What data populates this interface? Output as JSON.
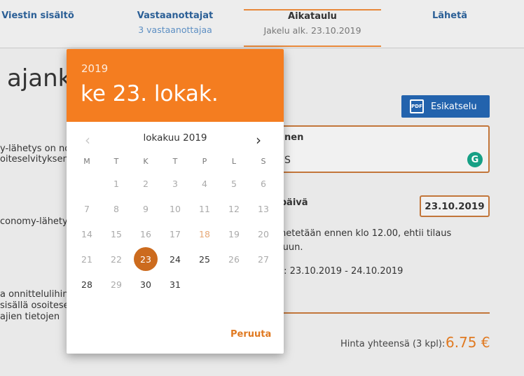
{
  "stepper": {
    "steps": [
      {
        "title": "Viestin sisältö",
        "sub": ""
      },
      {
        "title": "Vastaanottajat",
        "sub": "3 vastaanottajaa"
      },
      {
        "title": "Aikataulu",
        "sub": "Jakelu alk. 23.10.2019"
      },
      {
        "title": "Lähetä",
        "sub": ""
      }
    ],
    "active_index": 2
  },
  "page": {
    "heading_fragment": "ajank",
    "preview_button": "Esikatselu",
    "preview_icon": "pdf-icon",
    "field_label_fragment": "nen",
    "field_value_fragment": "S",
    "grammarly_icon_letter": "G",
    "left_text": [
      "y-lähetys on no",
      "oiteselvityksen",
      "conomy-lähetys",
      "a onnittelulihin",
      "sisällä osoitesel",
      "ajien tietojen"
    ],
    "date_label_fragment": "späivä",
    "date_value": "23.10.2019",
    "info_line1": "ähetetään ennen klo 12.00, ehtii tilaus",
    "info_line2": "eluun.",
    "info_line3": "ta: 23.10.2019 - 24.10.2019",
    "price_label": "Hinta yhteensä (3 kpl):",
    "price_value": "6.75 €"
  },
  "datepicker": {
    "header_year": "2019",
    "header_date": "ke 23. lokak.",
    "month_label": "lokakuu 2019",
    "prev_icon": "chevron-left-icon",
    "next_icon": "chevron-right-icon",
    "weekdays": [
      "M",
      "T",
      "K",
      "T",
      "P",
      "L",
      "S"
    ],
    "first_weekday_offset": 1,
    "days": [
      "1",
      "2",
      "3",
      "4",
      "5",
      "6",
      "7",
      "8",
      "9",
      "10",
      "11",
      "12",
      "13",
      "14",
      "15",
      "16",
      "17",
      "18",
      "19",
      "20",
      "21",
      "22",
      "23",
      "24",
      "25",
      "26",
      "27",
      "28",
      "29",
      "30",
      "31"
    ],
    "enabled_days": [
      "23",
      "24",
      "25",
      "28",
      "30",
      "31"
    ],
    "today_day": "18",
    "selected_day": "23",
    "cancel_label": "Peruuta"
  },
  "colors": {
    "accent": "#f47d20",
    "selected": "#cc6b1e",
    "link": "#2b5f96",
    "button": "#2363ad"
  }
}
